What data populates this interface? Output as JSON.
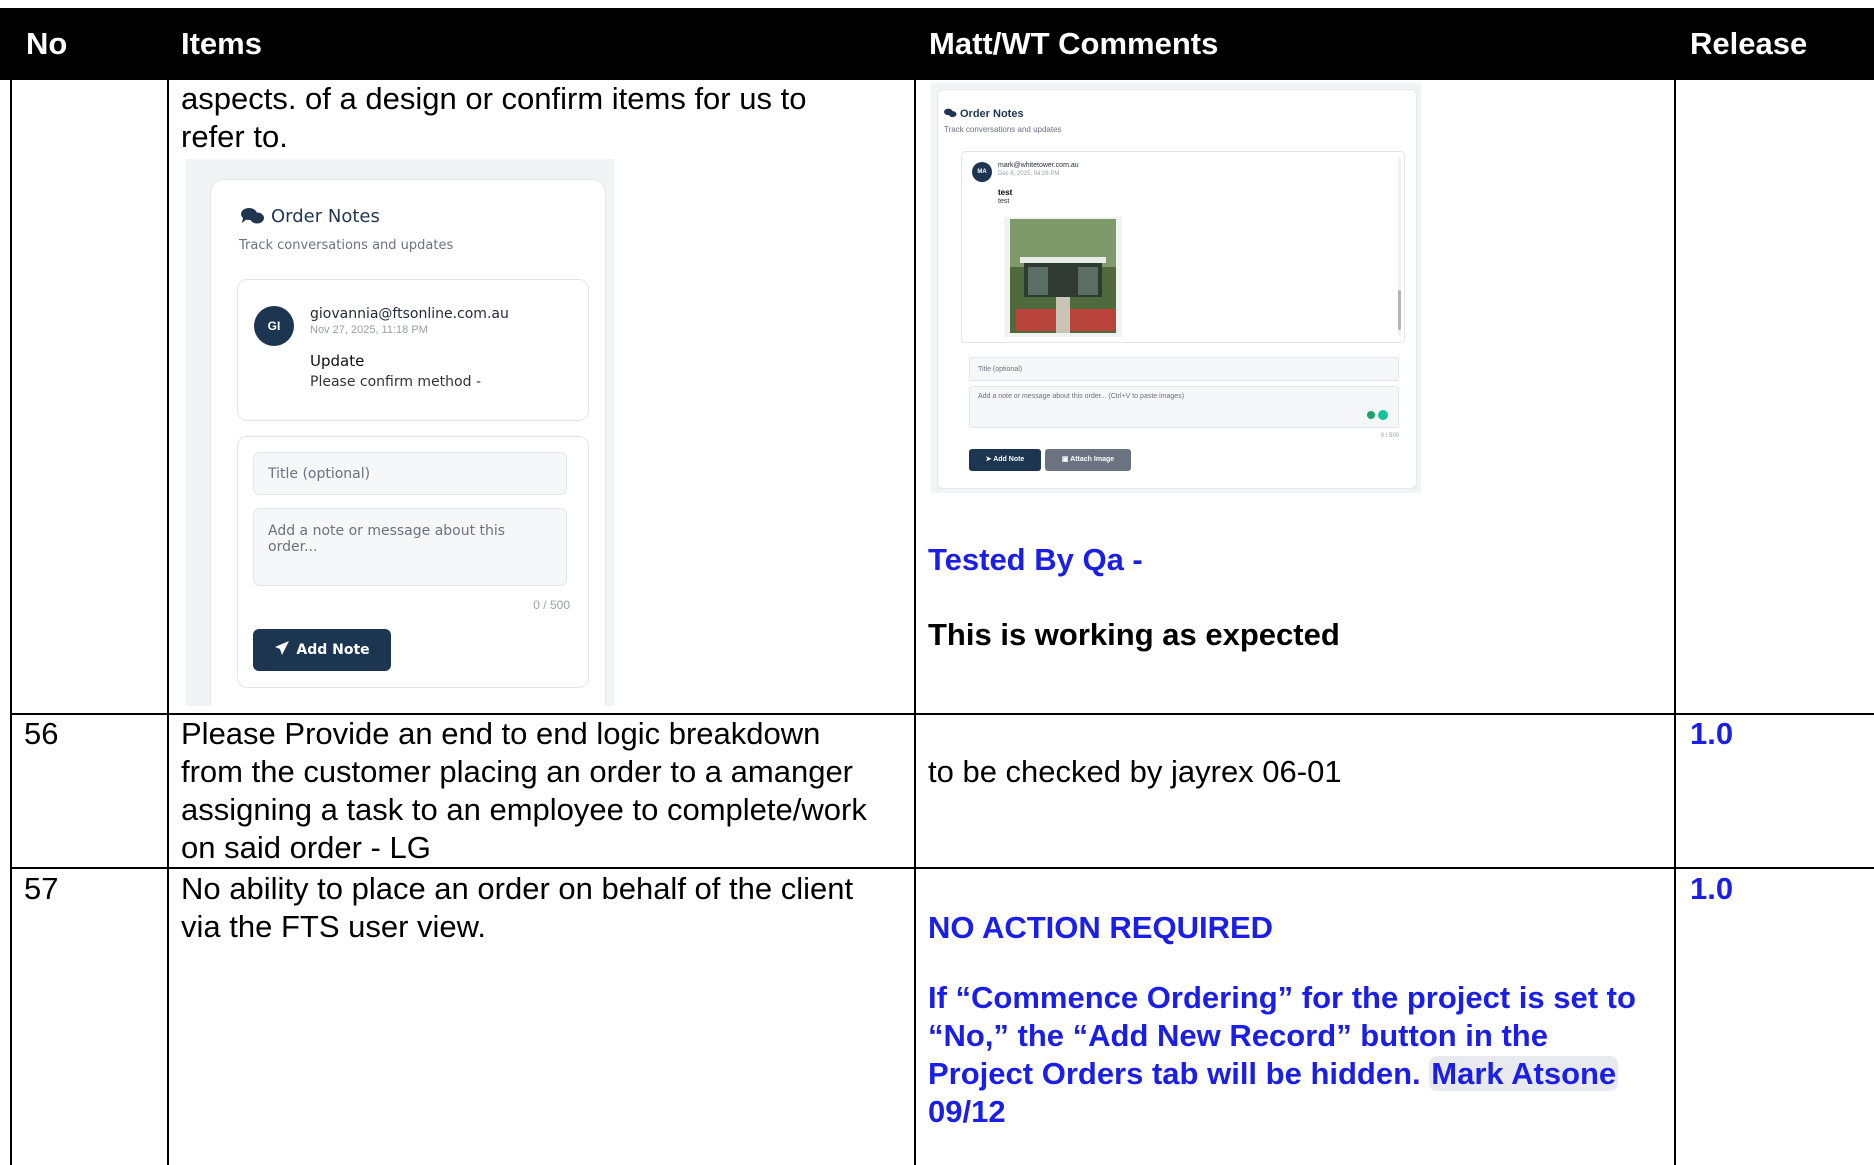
{
  "header": {
    "no": "No",
    "items": "Items",
    "comments": "Matt/WT Comments",
    "release": "Release"
  },
  "rows": [
    {
      "items_lines": [
        "aspects. of a design or confirm items for us to",
        "refer to."
      ],
      "shot1": {
        "title": "Order Notes",
        "subtitle": "Track conversations and updates",
        "avatar": "GI",
        "email": "giovannia@ftsonline.com.au",
        "date": "Nov 27, 2025, 11:18 PM",
        "note_title": "Update",
        "note_body": "Please confirm method -",
        "title_placeholder": "Title (optional)",
        "note_placeholder": "Add a note or message about this order...",
        "count": "0 / 500",
        "add_button": "Add Note"
      },
      "shot2": {
        "title": "Order Notes",
        "subtitle": "Track conversations and updates",
        "avatar": "MA",
        "email": "mark@whitetower.com.au",
        "date": "Dec 6, 2025, 04:26 PM",
        "note_title": "test",
        "note_body": "test",
        "title_placeholder": "Title (optional)",
        "note_placeholder": "Add a note or message about this order... (Ctrl+V to paste images)",
        "count": "0 / 500",
        "add_button": "Add Note",
        "attach_button": "Attach Image"
      },
      "tested_by": "Tested By Qa -",
      "working": "This is working as expected"
    },
    {
      "no": "56",
      "items_lines": [
        "Please Provide an end to end logic breakdown",
        "from the customer placing an order to a amanger",
        "assigning a task to an employee to complete/work",
        "on said order -  LG"
      ],
      "comment": "to be checked by jayrex 06-01",
      "release": "1.0"
    },
    {
      "no": "57",
      "items_lines": [
        "No ability to place an order on behalf of the client",
        "via the FTS user view."
      ],
      "no_action": "NO ACTION REQUIRED",
      "comment_lines": [
        "If “Commence Ordering” for the project is set to",
        "“No,” the “Add New Record” button in the",
        "Project Orders tab will be hidden."
      ],
      "mention": "Mark Atsone",
      "date": "09/12",
      "release": "1.0"
    }
  ]
}
